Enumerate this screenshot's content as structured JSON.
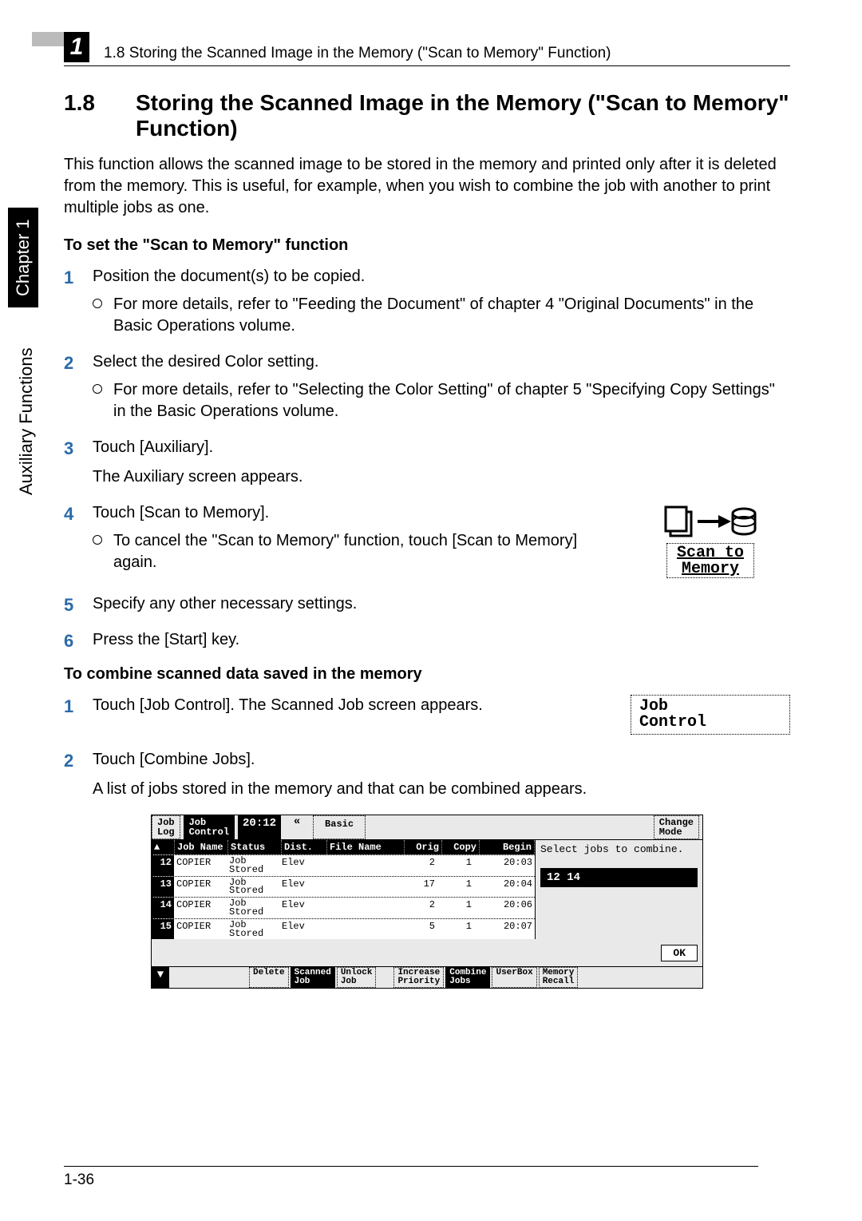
{
  "header": {
    "chapter_number": "1",
    "running_title": "1.8 Storing the Scanned Image in the Memory (\"Scan to Memory\" Function)"
  },
  "side": {
    "chapter_label": "Chapter 1",
    "section_label": "Auxiliary Functions"
  },
  "section": {
    "number": "1.8",
    "title": "Storing the Scanned Image in the Memory (\"Scan to Memory\" Function)",
    "intro": "This function allows the scanned image to be stored in the memory and printed only after it is deleted from the memory. This is useful, for example, when you wish to combine the job with another to print multiple jobs as one."
  },
  "proc1": {
    "heading": "To set the \"Scan to Memory\" function",
    "steps": [
      {
        "text": "Position the document(s) to be copied.",
        "sub": "For more details, refer to \"Feeding the Document\" of chapter 4 \"Original Documents\" in the Basic Operations volume."
      },
      {
        "text": "Select the desired Color setting.",
        "sub": "For more details, refer to \"Selecting the Color Setting\" of chapter 5 \"Specifying Copy Settings\" in the Basic Operations volume."
      },
      {
        "text": "Touch [Auxiliary].",
        "after": "The Auxiliary screen appears."
      },
      {
        "text": "Touch [Scan to Memory].",
        "sub": "To cancel the \"Scan to Memory\" function, touch [Scan to Memory] again."
      },
      {
        "text": "Specify any other necessary settings."
      },
      {
        "text": "Press the [Start] key."
      }
    ],
    "scan_widget_label": "Scan to\nMemory"
  },
  "proc2": {
    "heading": "To combine scanned data saved in the memory",
    "steps": [
      {
        "text": "Touch [Job Control]. The Scanned Job screen appears."
      },
      {
        "text": "Touch [Combine Jobs].",
        "after": "A list of jobs stored in the memory and that can be combined appears."
      }
    ],
    "job_control_label": "Job\nControl"
  },
  "panel": {
    "tabs": {
      "job_log": "Job\nLog",
      "job_control": "Job\nControl",
      "time": "20:12",
      "basic": "Basic",
      "change_mode": "Change\nMode"
    },
    "hdr": {
      "arrow": "▲",
      "name": "Job\nName",
      "status": "Status",
      "dist": "Dist.",
      "file": "File Name",
      "orig": "Orig",
      "copy": "Copy",
      "begin": "Begin"
    },
    "rows": [
      {
        "n": "12",
        "name": "COPIER",
        "status": "Job\nStored",
        "dist": "Elev",
        "file": "",
        "orig": "2",
        "copy": "1",
        "begin": "20:03"
      },
      {
        "n": "13",
        "name": "COPIER",
        "status": "Job\nStored",
        "dist": "Elev",
        "file": "",
        "orig": "17",
        "copy": "1",
        "begin": "20:04"
      },
      {
        "n": "14",
        "name": "COPIER",
        "status": "Job\nStored",
        "dist": "Elev",
        "file": "",
        "orig": "2",
        "copy": "1",
        "begin": "20:06"
      },
      {
        "n": "15",
        "name": "COPIER",
        "status": "Job\nStored",
        "dist": "Elev",
        "file": "",
        "orig": "5",
        "copy": "1",
        "begin": "20:07"
      }
    ],
    "right": {
      "prompt": "Select jobs to combine.",
      "selected": "12  14",
      "ok": "OK"
    },
    "bottom": {
      "arrow": "▼",
      "delete": "Delete",
      "scanned": "Scanned\nJob",
      "unlock": "Unlock\nJob",
      "increase": "Increase\nPriority",
      "combine": "Combine\nJobs",
      "userbox": "UserBox",
      "memory": "Memory\nRecall"
    }
  },
  "footer": {
    "page": "1-36"
  }
}
